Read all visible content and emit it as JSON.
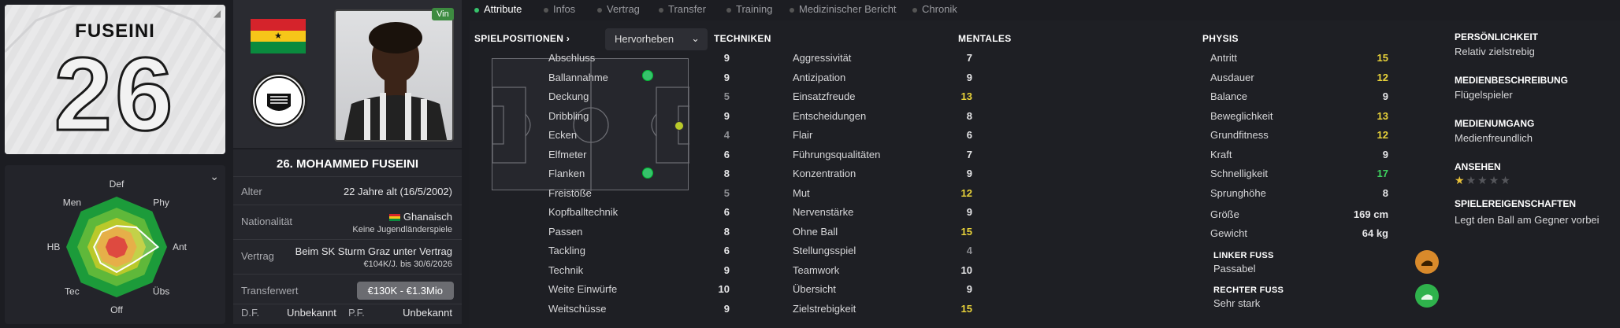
{
  "shirt": {
    "name": "FUSEINI",
    "number": "26"
  },
  "radar": {
    "labels": [
      "Def",
      "Phy",
      "Ant",
      "Übs",
      "Off",
      "Tec",
      "HB",
      "Men"
    ]
  },
  "player": {
    "full_name": "26. MOHAMMED FUSEINI",
    "badge": "Vin"
  },
  "info": {
    "alter_label": "Alter",
    "alter_value": "22 Jahre alt  (16/5/2002)",
    "nat_label": "Nationalität",
    "nat_value": "Ghanaisch",
    "nat_sub": "Keine Jugendländerspiele",
    "vertrag_label": "Vertrag",
    "vertrag_value": "Beim SK Sturm Graz unter Vertrag",
    "vertrag_sub": "€104K/J. bis 30/6/2026",
    "transfer_label": "Transferwert",
    "transfer_value": "€130K - €1.3Mio",
    "df_label": "D.F.",
    "df_value": "Unbekannt",
    "pf_label": "P.F.",
    "pf_value": "Unbekannt"
  },
  "tabs": [
    "Attribute",
    "Infos",
    "Vertrag",
    "Transfer",
    "Training",
    "Medizinischer Bericht",
    "Chronik"
  ],
  "positions": {
    "title": "SPIELPOSITIONEN",
    "dropdown": "Hervorheben"
  },
  "techniken": {
    "title": "TECHNIKEN",
    "items": [
      {
        "name": "Abschluss",
        "value": "9",
        "tier": "mid"
      },
      {
        "name": "Ballannahme",
        "value": "9",
        "tier": "mid"
      },
      {
        "name": "Deckung",
        "value": "5",
        "tier": "low"
      },
      {
        "name": "Dribbling",
        "value": "9",
        "tier": "mid"
      },
      {
        "name": "Ecken",
        "value": "4",
        "tier": "low"
      },
      {
        "name": "Elfmeter",
        "value": "6",
        "tier": "mid"
      },
      {
        "name": "Flanken",
        "value": "8",
        "tier": "mid"
      },
      {
        "name": "Freistöße",
        "value": "5",
        "tier": "low"
      },
      {
        "name": "Kopfballtechnik",
        "value": "6",
        "tier": "mid"
      },
      {
        "name": "Passen",
        "value": "8",
        "tier": "mid"
      },
      {
        "name": "Tackling",
        "value": "6",
        "tier": "mid"
      },
      {
        "name": "Technik",
        "value": "9",
        "tier": "mid"
      },
      {
        "name": "Weite Einwürfe",
        "value": "10",
        "tier": "mid"
      },
      {
        "name": "Weitschüsse",
        "value": "9",
        "tier": "mid"
      }
    ]
  },
  "mentales": {
    "title": "MENTALES",
    "items": [
      {
        "name": "Aggressivität",
        "value": "7",
        "tier": "mid"
      },
      {
        "name": "Antizipation",
        "value": "9",
        "tier": "mid"
      },
      {
        "name": "Einsatzfreude",
        "value": "13",
        "tier": "hi"
      },
      {
        "name": "Entscheidungen",
        "value": "8",
        "tier": "mid"
      },
      {
        "name": "Flair",
        "value": "6",
        "tier": "mid"
      },
      {
        "name": "Führungsqualitäten",
        "value": "7",
        "tier": "mid"
      },
      {
        "name": "Konzentration",
        "value": "9",
        "tier": "mid"
      },
      {
        "name": "Mut",
        "value": "12",
        "tier": "hi"
      },
      {
        "name": "Nervenstärke",
        "value": "9",
        "tier": "mid"
      },
      {
        "name": "Ohne Ball",
        "value": "15",
        "tier": "hi"
      },
      {
        "name": "Stellungsspiel",
        "value": "4",
        "tier": "low"
      },
      {
        "name": "Teamwork",
        "value": "10",
        "tier": "mid"
      },
      {
        "name": "Übersicht",
        "value": "9",
        "tier": "mid"
      },
      {
        "name": "Zielstrebigkeit",
        "value": "15",
        "tier": "hi"
      }
    ]
  },
  "physis": {
    "title": "PHYSIS",
    "items": [
      {
        "name": "Antritt",
        "value": "15",
        "tier": "hi"
      },
      {
        "name": "Ausdauer",
        "value": "12",
        "tier": "hi"
      },
      {
        "name": "Balance",
        "value": "9",
        "tier": "mid"
      },
      {
        "name": "Beweglichkeit",
        "value": "13",
        "tier": "hi"
      },
      {
        "name": "Grundfitness",
        "value": "12",
        "tier": "hi"
      },
      {
        "name": "Kraft",
        "value": "9",
        "tier": "mid"
      },
      {
        "name": "Schnelligkeit",
        "value": "17",
        "tier": "top"
      },
      {
        "name": "Sprunghöhe",
        "value": "8",
        "tier": "mid"
      }
    ],
    "groesse_label": "Größe",
    "groesse_value": "169 cm",
    "gewicht_label": "Gewicht",
    "gewicht_value": "64 kg",
    "linker_fuss_title": "LINKER FUSS",
    "linker_fuss_value": "Passabel",
    "rechter_fuss_title": "RECHTER FUSS",
    "rechter_fuss_value": "Sehr stark"
  },
  "side": {
    "persoenlichkeit_title": "PERSÖNLICHKEIT",
    "persoenlichkeit_value": "Relativ zielstrebig",
    "medien_title": "MEDIENBESCHREIBUNG",
    "medien_value": "Flügelspieler",
    "umgang_title": "MEDIENUMGANG",
    "umgang_value": "Medienfreundlich",
    "ansehen_title": "ANSEHEN",
    "ansehen_stars": 1,
    "eigen_title": "SPIELEREIGENSCHAFTEN",
    "eigen_value": "Legt den Ball am Gegner vorbei"
  },
  "colors": {
    "accent": "#36c26b",
    "highlight": "#e9d33a",
    "top": "#3ed35f",
    "foot_left": "#d98a2b",
    "foot_right": "#2fb24c"
  }
}
